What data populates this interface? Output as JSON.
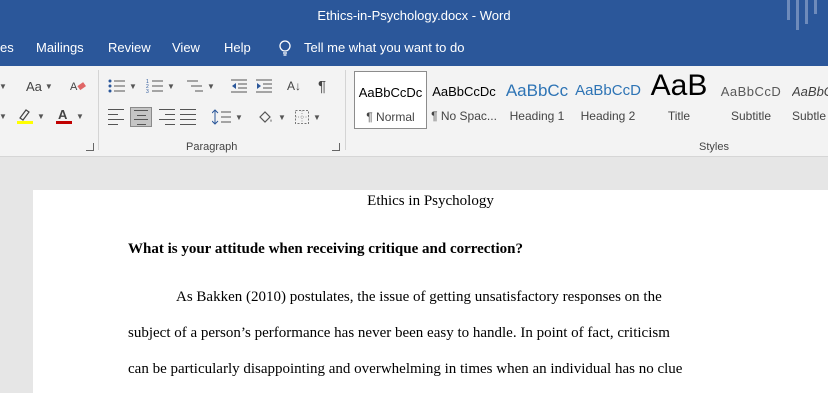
{
  "window": {
    "title": "Ethics-in-Psychology.docx  -  Word"
  },
  "tabs": [
    "es",
    "Mailings",
    "Review",
    "View",
    "Help"
  ],
  "tell_me": "Tell me what you want to do",
  "ribbon": {
    "font_case_label": "Aa",
    "paragraph_group_label": "Paragraph",
    "styles_group_label": "Styles",
    "pilcrow": "¶",
    "sort_label": "A↓"
  },
  "styles": [
    {
      "preview": "AaBbCcDc",
      "label": "¶ Normal"
    },
    {
      "preview": "AaBbCcDc",
      "label": "¶ No Spac..."
    },
    {
      "preview": "AaBbCc",
      "label": "Heading 1"
    },
    {
      "preview": "AaBbCcD",
      "label": "Heading 2"
    },
    {
      "preview": "AaB",
      "label": "Title"
    },
    {
      "preview": "AaBbCcD",
      "label": "Subtitle"
    },
    {
      "preview": "AaBbC",
      "label": "Subtle"
    }
  ],
  "document": {
    "title": "Ethics in Psychology",
    "heading": "What is your attitude when receiving critique and correction?",
    "lines": [
      "As Bakken (2010) postulates, the issue of getting unsatisfactory responses on the",
      "subject of a person’s performance has never been easy to handle. In point of fact, criticism",
      "can be particularly disappointing and overwhelming in times when an individual has no clue"
    ]
  },
  "colors": {
    "titlebar": "#2b579a",
    "highlight": "#ffff00",
    "font_color": "#c00000",
    "heading_style": "#2e74b5"
  }
}
